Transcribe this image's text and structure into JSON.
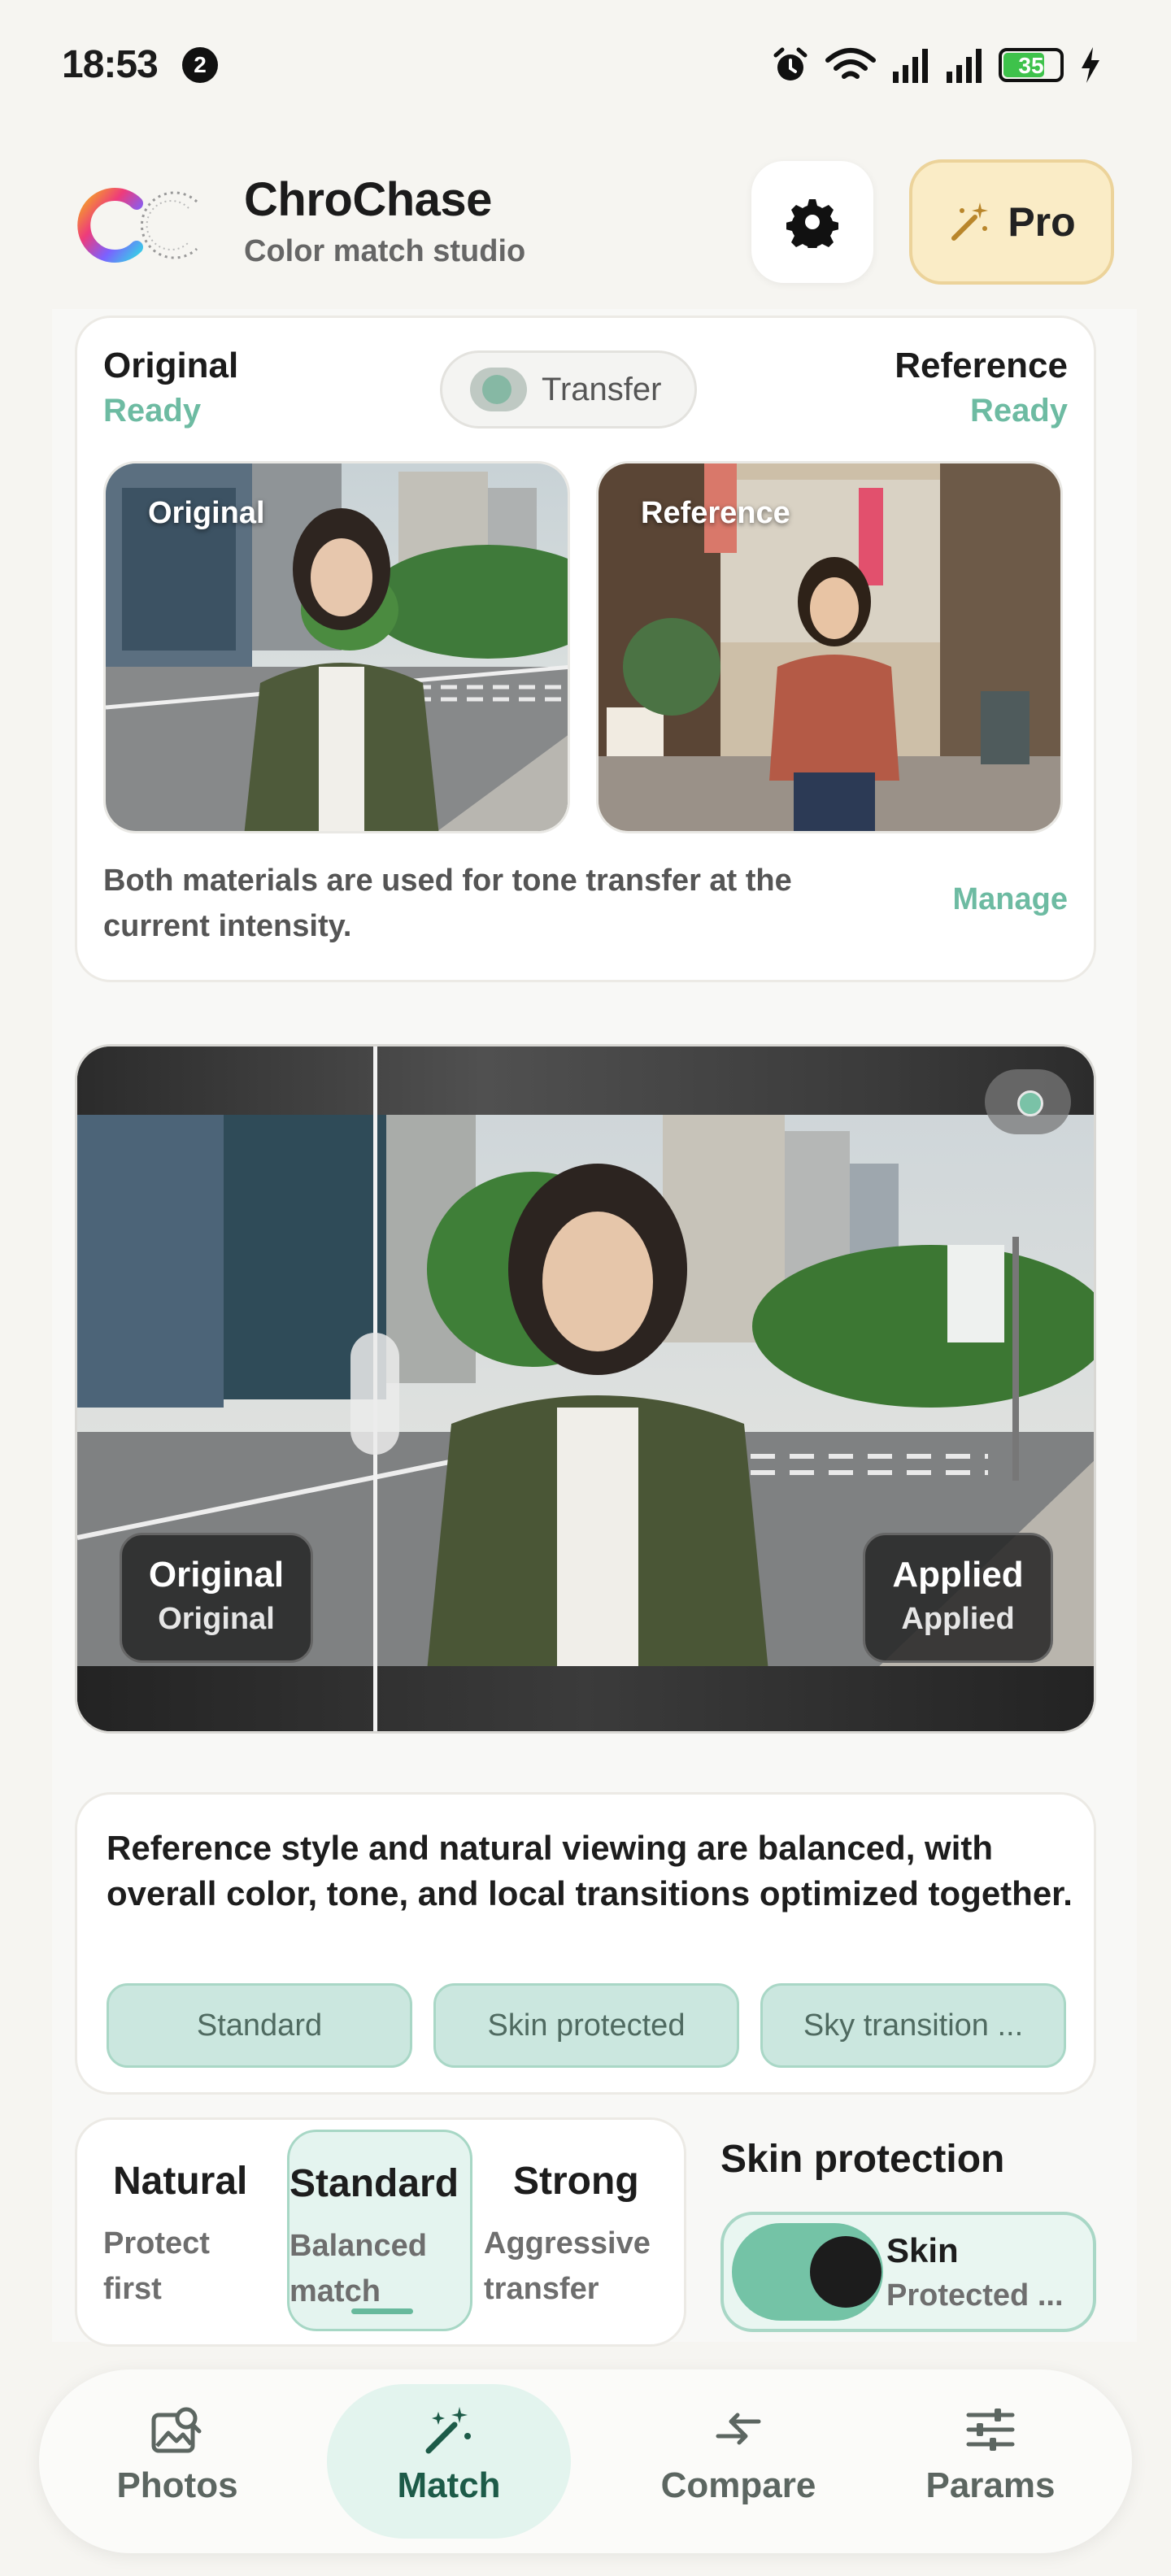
{
  "status_bar": {
    "time": "18:53",
    "notification_count": "2",
    "battery": "35"
  },
  "header": {
    "app_name": "ChroChase",
    "subtitle": "Color match studio",
    "pro_label": "Pro"
  },
  "materials": {
    "original_title": "Original",
    "original_status": "Ready",
    "reference_title": "Reference",
    "reference_status": "Ready",
    "transfer_label": "Transfer",
    "original_tag": "Original",
    "reference_tag": "Reference",
    "description": "Both materials are used for tone transfer at the current intensity.",
    "manage_label": "Manage"
  },
  "compare": {
    "left_title": "Original",
    "left_sub": "Original",
    "right_title": "Applied",
    "right_sub": "Applied"
  },
  "summary": {
    "text": "Reference style and natural viewing are balanced, with overall color, tone, and local transitions optimized together.",
    "chips": [
      "Standard",
      "Skin protected",
      "Sky transition ..."
    ]
  },
  "intensity": {
    "levels": [
      {
        "name": "Natural",
        "sub": "Protect first"
      },
      {
        "name": "Standard",
        "sub": "Balanced match"
      },
      {
        "name": "Strong",
        "sub": "Aggressive transfer"
      }
    ],
    "selected": "Standard"
  },
  "skin_protection": {
    "title": "Skin protection",
    "toggle_label": "Skin",
    "toggle_sub": "Protected ...",
    "enabled": true
  },
  "nav": {
    "items": [
      {
        "label": "Photos",
        "icon": "photo-search-icon"
      },
      {
        "label": "Match",
        "icon": "magic-wand-icon"
      },
      {
        "label": "Compare",
        "icon": "compare-arrows-icon"
      },
      {
        "label": "Params",
        "icon": "sliders-icon"
      }
    ],
    "active": "Match"
  },
  "colors": {
    "accent": "#6dbba2",
    "accent_light": "#e3f4ee",
    "pro_bg": "#faecc6",
    "background": "#f6f5f1"
  }
}
